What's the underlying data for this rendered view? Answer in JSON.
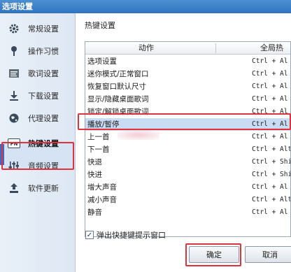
{
  "window": {
    "title": "选项设置"
  },
  "sidebar": {
    "items": [
      {
        "label": "常规设置",
        "icon": "gear-icon"
      },
      {
        "label": "操作习惯",
        "icon": "pin-icon"
      },
      {
        "label": "歌词设置",
        "icon": "lyrics-icon"
      },
      {
        "label": "下载设置",
        "icon": "download-icon"
      },
      {
        "label": "代理设置",
        "icon": "globe-icon"
      },
      {
        "label": "热键设置",
        "icon": "fn-key-icon"
      },
      {
        "label": "音频设置",
        "icon": "equalizer-icon"
      },
      {
        "label": "软件更新",
        "icon": "update-icon"
      }
    ],
    "active_index": 5
  },
  "panel": {
    "title": "热键设置",
    "table": {
      "headers": [
        "动作",
        "全局热"
      ],
      "rows": [
        {
          "action": "选项设置",
          "key": "Ctrl + Al"
        },
        {
          "action": "迷你模式/正常窗口",
          "key": "Ctrl + Al"
        },
        {
          "action": "恢复窗口默认尺寸",
          "key": "Ctrl + Al"
        },
        {
          "action": "显示/隐藏桌面歌词",
          "key": "Ctrl + Al"
        },
        {
          "action": "锁定/解锁桌面歌词",
          "key": "Ctrl + Al"
        },
        {
          "action": "播放/暂停",
          "key": "Ctrl + Al"
        },
        {
          "action": "上一首",
          "key": "Ctrl + Al"
        },
        {
          "action": "下一首",
          "key": "Ctrl + Alt"
        },
        {
          "action": "快退",
          "key": "Ctrl + Shif"
        },
        {
          "action": "快进",
          "key": "Ctrl + Shift"
        },
        {
          "action": "增大声音",
          "key": "Ctrl + Al"
        },
        {
          "action": "减小声音",
          "key": "Ctrl + Alt"
        },
        {
          "action": "静音",
          "key": "Ctrl + Al"
        }
      ],
      "selected_index": 5
    },
    "checkbox": {
      "label": "弹出快捷键提示窗口",
      "checked": true
    }
  },
  "buttons": {
    "ok": "确定",
    "cancel": "取消"
  },
  "colors": {
    "accent": "#2e6fd0",
    "highlight": "#e0323a",
    "selection": "#c9dcf3"
  }
}
